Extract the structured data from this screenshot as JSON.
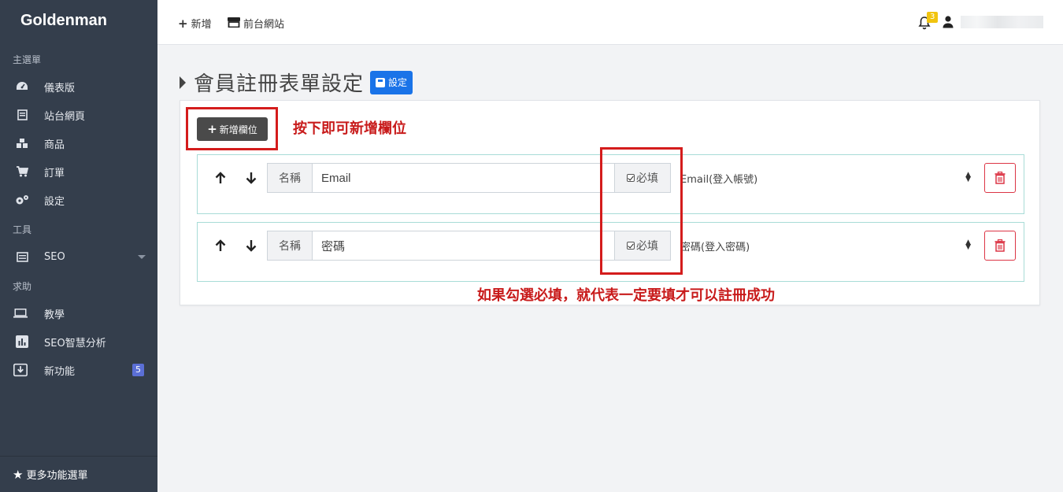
{
  "sidebar": {
    "brand": "Goldenman",
    "sections": [
      "主選單",
      "工具",
      "求助"
    ],
    "main_items": [
      {
        "label": "儀表版",
        "icon": "dashboard-icon"
      },
      {
        "label": "站台網頁",
        "icon": "webpage-icon"
      },
      {
        "label": "商品",
        "icon": "products-icon"
      },
      {
        "label": "訂單",
        "icon": "cart-icon"
      },
      {
        "label": "設定",
        "icon": "settings-icon"
      }
    ],
    "tool_items": [
      {
        "label": "SEO",
        "icon": "list-icon"
      }
    ],
    "help_items": [
      {
        "label": "教學",
        "icon": "laptop-icon"
      },
      {
        "label": "SEO智慧分析",
        "icon": "chart-icon"
      },
      {
        "label": "新功能",
        "icon": "download-icon",
        "badge": "5"
      }
    ],
    "footer": "更多功能選單"
  },
  "topbar": {
    "add_label": "新增",
    "frontend_label": "前台網站",
    "notification_count": "3"
  },
  "page": {
    "title": "會員註冊表單設定",
    "save_label": "設定",
    "add_field_label": "新增欄位"
  },
  "fields": [
    {
      "name_addon": "名稱",
      "name_value": "Email",
      "required_label": "必填",
      "type": "Email(登入帳號)"
    },
    {
      "name_addon": "名稱",
      "name_value": "密碼",
      "required_label": "必填",
      "type": "密碼(登入密碼)"
    }
  ],
  "annotations": {
    "add_hint": "按下即可新增欄位",
    "required_hint": "如果勾選必填，就代表一定要填才可以註冊成功"
  },
  "colors": {
    "sidebar_bg": "#343e4c",
    "primary": "#1a73e8",
    "danger": "#dc3545",
    "annotation": "#d41c1c",
    "row_border": "#a8dcd7"
  }
}
